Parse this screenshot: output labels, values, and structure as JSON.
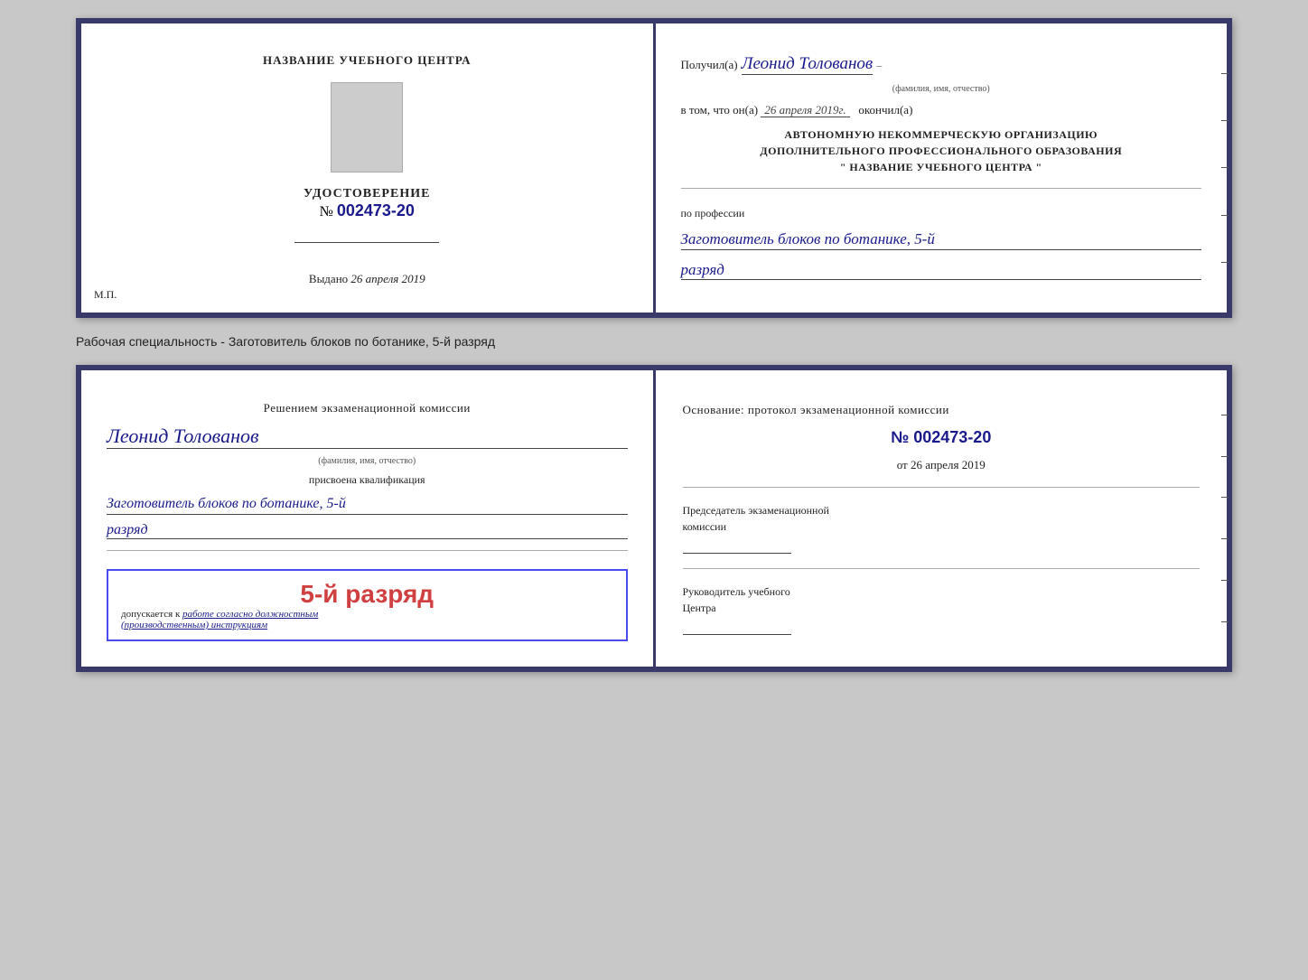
{
  "doc1": {
    "left": {
      "title": "НАЗВАНИЕ УЧЕБНОГО ЦЕНТРА",
      "udostoverenie": "УДОСТОВЕРЕНИЕ",
      "number_label": "№",
      "number": "002473-20",
      "vydano_label": "Выдано",
      "vydano_date": "26 апреля 2019",
      "mp": "М.П."
    },
    "right": {
      "poluchil": "Получил(а)",
      "name": "Леонид Толованов",
      "name_caption": "(фамилия, имя, отчество)",
      "vtom_label": "в том, что он(а)",
      "vtom_date": "26 апреля 2019г.",
      "okonchil": "окончил(а)",
      "org_line1": "АВТОНОМНУЮ НЕКОММЕРЧЕСКУЮ ОРГАНИЗАЦИЮ",
      "org_line2": "ДОПОЛНИТЕЛЬНОГО ПРОФЕССИОНАЛЬНОГО ОБРАЗОВАНИЯ",
      "org_line3": "\"  НАЗВАНИЕ УЧЕБНОГО ЦЕНТРА  \"",
      "professiya_label": "по профессии",
      "professiya_value": "Заготовитель блоков по ботанике, 5-й",
      "razryad_value": "разряд"
    }
  },
  "specialty_label": "Рабочая специальность - Заготовитель блоков по ботанике, 5-й разряд",
  "doc2": {
    "left": {
      "resheniem": "Решением экзаменационной комиссии",
      "name": "Леонид Толованов",
      "name_caption": "(фамилия, имя, отчество)",
      "prisvoena": "присвоена квалификация",
      "kvalif": "Заготовитель блоков по ботанике, 5-й",
      "razryad": "разряд",
      "stamp_text": "5-й разряд",
      "dopuskaetsya": "допускается к",
      "work_text": "работе согласно должностным",
      "instruktsii": "(производственным) инструкциям"
    },
    "right": {
      "osnovanie": "Основание: протокол экзаменационной комиссии",
      "number_label": "№",
      "number": "002473-20",
      "ot_label": "от",
      "ot_date": "26 апреля 2019",
      "chairman_label": "Председатель экзаменационной",
      "chairman_label2": "комиссии",
      "rukovoditel_label": "Руководитель учебного",
      "rukovoditel_label2": "Центра"
    }
  }
}
